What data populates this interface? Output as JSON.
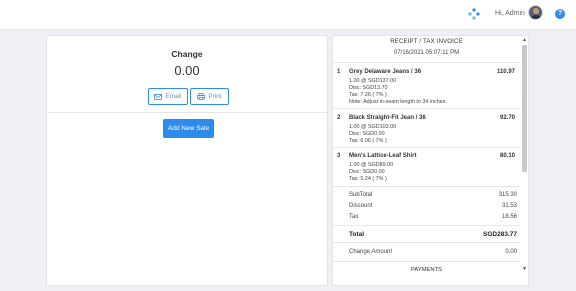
{
  "header": {
    "greeting": "Hi, Admin",
    "logo_icon": "diamond-logo-icon",
    "help_icon": "question-icon",
    "help_label": "?"
  },
  "left": {
    "change_label": "Change",
    "change_value": "0.00",
    "email_label": "Email",
    "print_label": "Print",
    "new_sale_label": "Add New Sale"
  },
  "receipt": {
    "title": "RECEIPT / TAX INVOICE",
    "date": "07/16/2021 05:07:11 PM",
    "items": [
      {
        "num": "1",
        "name": "Grey Delaware Jeans / 36",
        "price": "110.97",
        "qty_line": "1.00 @ SGD137.00",
        "disc_line": "Disc: SGD13.70",
        "tax_line": "Tax: 7.26 ( 7% )",
        "note": "Note: Adjust in-seam length to 34 inches."
      },
      {
        "num": "2",
        "name": "Black Straight-Fit Jean / 36",
        "price": "92.70",
        "qty_line": "1.00 @ SGD103.00",
        "disc_line": "Disc: SGD0.00",
        "tax_line": "Tax: 6.06 ( 7% )"
      },
      {
        "num": "3",
        "name": "Men's Lattice-Leaf Shirt",
        "price": "80.10",
        "qty_line": "1.00 @ SGD89.00",
        "disc_line": "Disc: SGD0.00",
        "tax_line": "Tax: 5.24 ( 7% )"
      }
    ],
    "summary": {
      "subtotal_label": "SubTotal",
      "subtotal_value": "315.30",
      "discount_label": "Discount",
      "discount_value": "31.53",
      "tax_label": "Tax",
      "tax_value": "18.56",
      "total_label": "Total",
      "total_value": "SGD283.77",
      "change_label": "Change Amount",
      "change_value": "0.00"
    },
    "payments_label": "PAYMENTS"
  },
  "colors": {
    "accent": "#2d8ceb",
    "background": "#eef0f5"
  }
}
